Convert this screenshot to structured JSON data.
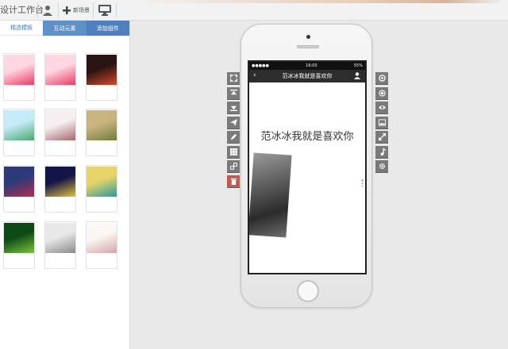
{
  "app": {
    "title": "设计工作台"
  },
  "toolbar": {
    "new_scene_label": "新场景"
  },
  "left_panel": {
    "tabs": [
      {
        "label": "精选模板",
        "active": true
      },
      {
        "label": "互动元素",
        "active": false
      },
      {
        "label": "添加组件",
        "active": false
      }
    ],
    "templates": [
      {
        "name": "template-1",
        "colors": [
          "#ffd7e2",
          "#e83b64"
        ]
      },
      {
        "name": "template-2",
        "colors": [
          "#ffd7e2",
          "#e83b64"
        ]
      },
      {
        "name": "template-3",
        "colors": [
          "#2a1414",
          "#d9482b"
        ]
      },
      {
        "name": "template-4",
        "colors": [
          "#c4ebf7",
          "#48a86b"
        ]
      },
      {
        "name": "template-5",
        "colors": [
          "#f5eff0",
          "#a5676f"
        ]
      },
      {
        "name": "template-6",
        "colors": [
          "#c9b37f",
          "#6f7c3f"
        ]
      },
      {
        "name": "template-7",
        "colors": [
          "#2d3a7a",
          "#b52d4b"
        ]
      },
      {
        "name": "template-8",
        "colors": [
          "#141447",
          "#e0c33a"
        ]
      },
      {
        "name": "template-9",
        "colors": [
          "#e7d36a",
          "#2a9c9a"
        ]
      },
      {
        "name": "template-10",
        "colors": [
          "#0f4a16",
          "#7bc43b"
        ]
      },
      {
        "name": "template-11",
        "colors": [
          "#e8e8e8",
          "#8a8a8a"
        ]
      },
      {
        "name": "template-12",
        "colors": [
          "#fbf7f2",
          "#d5a3ab"
        ]
      }
    ]
  },
  "phone": {
    "status": {
      "carrier": "●●●●●",
      "time": "16:03",
      "battery": "55%"
    },
    "nav_title": "范冰冰我就是喜欢你",
    "headline": "范冰冰我就是喜欢你"
  },
  "left_tools": [
    "fullscreen-icon",
    "align-top-icon",
    "align-bottom-icon",
    "send-icon",
    "edit-icon",
    "grid-icon",
    "link-icon",
    "trash-icon"
  ],
  "right_tools": [
    "settings-icon",
    "target-icon",
    "eye-icon",
    "image-icon",
    "expand-icon",
    "music-icon",
    "gear-icon"
  ]
}
